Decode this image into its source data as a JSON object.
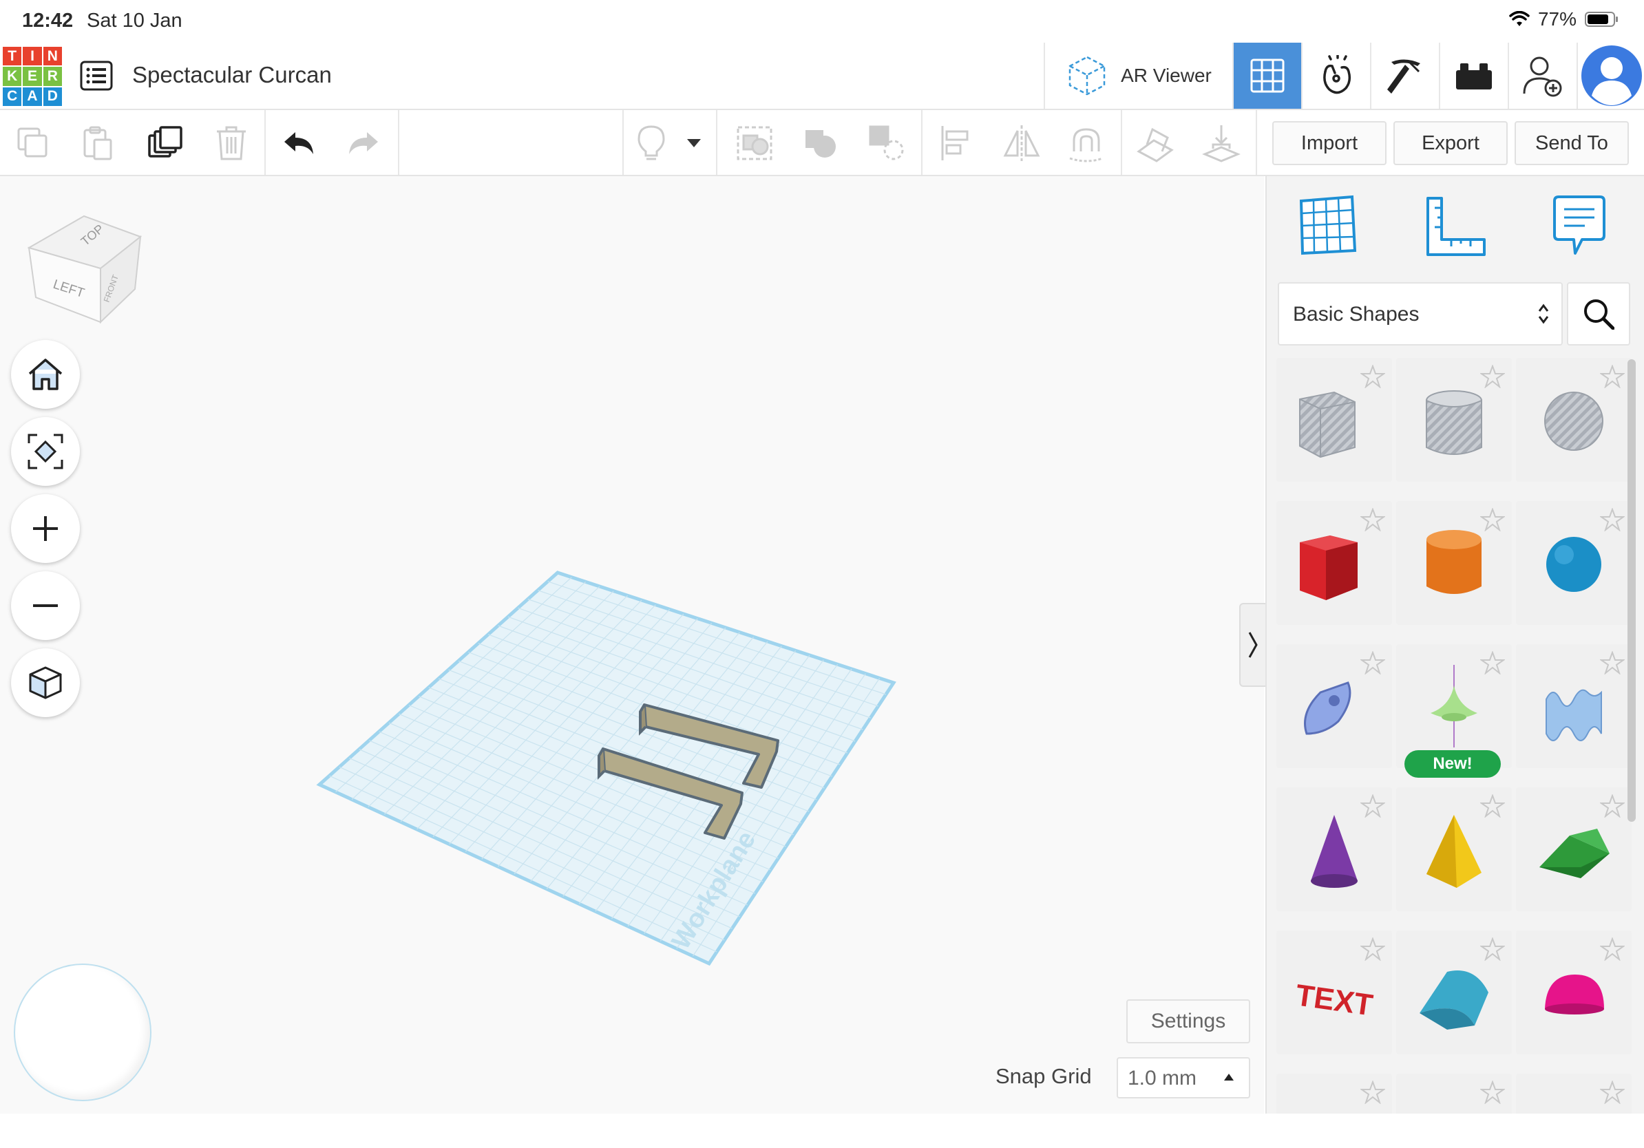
{
  "status_bar": {
    "time": "12:42",
    "date": "Sat 10 Jan",
    "battery": "77%"
  },
  "header": {
    "logo_letters": [
      "T",
      "I",
      "N",
      "K",
      "E",
      "R",
      "C",
      "A",
      "D"
    ],
    "logo_colors": [
      "#e8412d",
      "#e8412d",
      "#e8412d",
      "#7ac142",
      "#7ac142",
      "#7ac142",
      "#1e8fd4",
      "#1e8fd4",
      "#1e8fd4"
    ],
    "design_title": "Spectacular Curcan",
    "ar_viewer_label": "AR Viewer",
    "accent": "#4a90d9"
  },
  "toolbar": {
    "import_label": "Import",
    "export_label": "Export",
    "send_to_label": "Send To"
  },
  "viewcube": {
    "top": "TOP",
    "left": "LEFT",
    "front": "FRONT"
  },
  "workplane": {
    "label": "Workplane"
  },
  "bottom": {
    "settings_label": "Settings",
    "snap_grid_label": "Snap Grid",
    "snap_grid_value": "1.0 mm"
  },
  "panel": {
    "category": "Basic Shapes",
    "new_badge": "New!",
    "shapes": [
      {
        "name": "Box (hole)",
        "color": "#b8bcc4"
      },
      {
        "name": "Cylinder (hole)",
        "color": "#b8bcc4"
      },
      {
        "name": "Sphere (hole)",
        "color": "#b8bcc4"
      },
      {
        "name": "Box",
        "color": "#d8232a"
      },
      {
        "name": "Cylinder",
        "color": "#e3731b"
      },
      {
        "name": "Sphere",
        "color": "#1b8fc7"
      },
      {
        "name": "Scribble",
        "color": "#8fa6e6"
      },
      {
        "name": "Spinning top",
        "color": "#a8e08c"
      },
      {
        "name": "Wave",
        "color": "#9cc3ec"
      },
      {
        "name": "Cone",
        "color": "#7b3aa6"
      },
      {
        "name": "Pyramid",
        "color": "#f2c81a"
      },
      {
        "name": "Roof",
        "color": "#2e9a3a"
      },
      {
        "name": "Text",
        "color": "#d0232a",
        "text": "TEXT"
      },
      {
        "name": "Half cylinder",
        "color": "#3aa9c9"
      },
      {
        "name": "Half sphere",
        "color": "#e6148a"
      }
    ]
  }
}
